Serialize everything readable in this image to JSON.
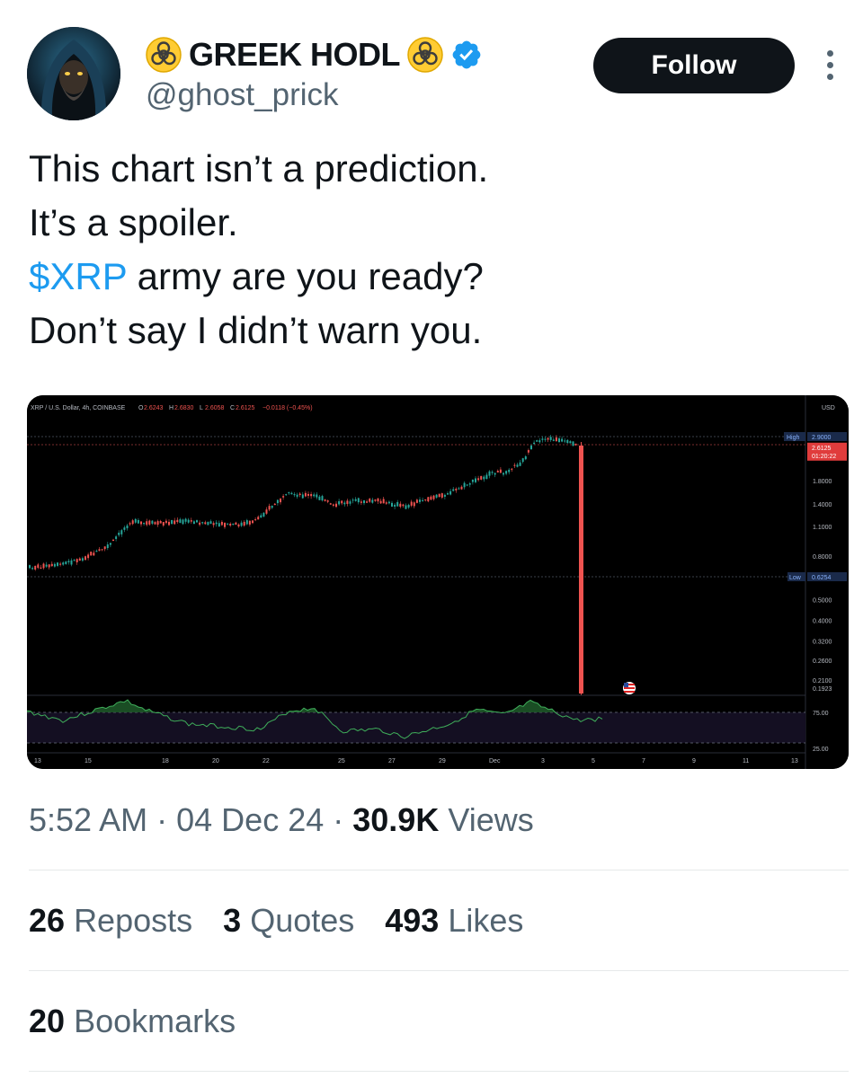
{
  "author": {
    "name": "GREEK HODL",
    "handle": "@ghost_prick",
    "verified": true,
    "name_emoji": "biohazard-emoji-icon"
  },
  "follow_label": "Follow",
  "tweet": {
    "lines": [
      "This chart isn’t a prediction.",
      "It’s a spoiler."
    ],
    "cashtag": "$XRP",
    "line3_rest": " army are you ready?",
    "line4": "Don’t say I didn’t warn you."
  },
  "chart_header": {
    "symbol": "XRP / U.S. Dollar, 4h, COINBASE",
    "open_label": "O",
    "open": "2.6243",
    "high_label": "H",
    "high": "2.6830",
    "low_label": "L",
    "low": "2.6058",
    "close_label": "C",
    "close": "2.6125",
    "change": "−0.0118 (−0.45%)"
  },
  "chart_data": {
    "type": "line",
    "title": "",
    "price_axis_unit": "USD",
    "price_levels": [
      "1.8000",
      "1.4000",
      "1.1000",
      "0.8000",
      "0.5000",
      "0.4000",
      "0.3200",
      "0.2600",
      "0.2100",
      "0.1923"
    ],
    "high_marker": {
      "label": "High",
      "value": "2.9000"
    },
    "current_marker": {
      "value": "2.6125",
      "countdown": "01:20:22"
    },
    "low_marker": {
      "label": "Low",
      "value": "0.6254"
    },
    "indicator_levels": [
      "75.00",
      "25.00"
    ],
    "x_ticks": [
      "13",
      "15",
      "18",
      "20",
      "22",
      "25",
      "27",
      "29",
      "Dec",
      "3",
      "5",
      "7",
      "9",
      "11",
      "13"
    ],
    "series": [
      {
        "x": [
          "13",
          "15",
          "18",
          "20",
          "22",
          "25",
          "27",
          "29",
          "Dec",
          "3",
          "4"
        ],
        "values": [
          0.64,
          0.85,
          1.15,
          1.12,
          1.45,
          1.4,
          1.4,
          1.52,
          1.9,
          2.6,
          0.19
        ]
      }
    ],
    "grid": false,
    "legend": "none",
    "colors": {
      "up": "#26a69a",
      "down": "#ef5350",
      "background": "#000000",
      "rsi": "#3fae5a"
    }
  },
  "timestamp": "5:52 AM",
  "date": "04 Dec 24",
  "views_count": "30.9K",
  "views_label": "Views",
  "separator": "·",
  "stats": {
    "reposts_count": "26",
    "reposts_label": "Reposts",
    "quotes_count": "3",
    "quotes_label": "Quotes",
    "likes_count": "493",
    "likes_label": "Likes",
    "bookmarks_count": "20",
    "bookmarks_label": "Bookmarks"
  },
  "colors": {
    "link": "#1d9bf0",
    "secondary_text": "#536471",
    "primary_text": "#0f1419",
    "follow_bg": "#0f1419",
    "verified": "#1d9bf0"
  }
}
